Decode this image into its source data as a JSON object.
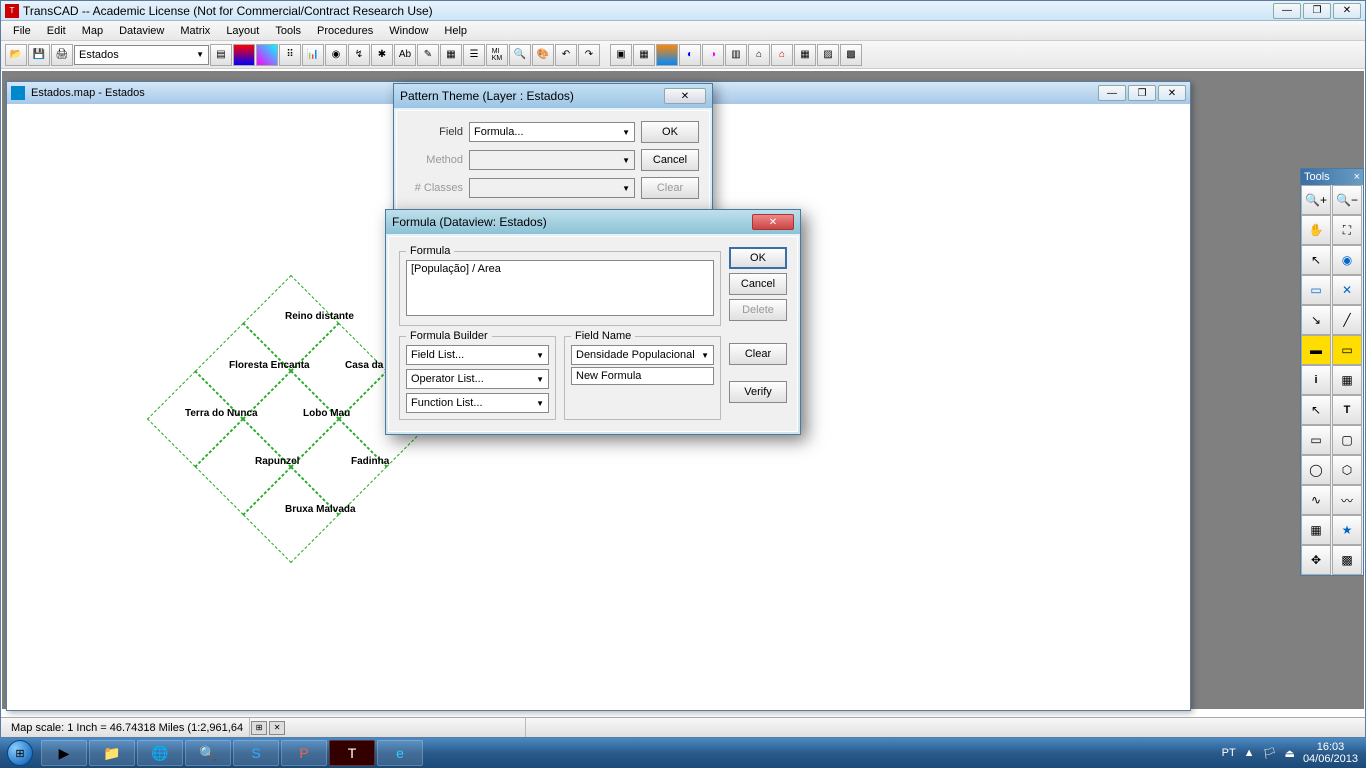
{
  "app": {
    "title": "TransCAD -- Academic License (Not for Commercial/Contract Research Use)",
    "menus": [
      "File",
      "Edit",
      "Map",
      "Dataview",
      "Matrix",
      "Layout",
      "Tools",
      "Procedures",
      "Window",
      "Help"
    ],
    "layer_combo": "Estados"
  },
  "map_window": {
    "title": "Estados.map - Estados",
    "regions": [
      "Reino distante",
      "Floresta Encanta",
      "Casa da",
      "Terra do Nunca",
      "Lobo Mau",
      "Rapunzel",
      "Fadinha",
      "Bruxa Malvada"
    ]
  },
  "pattern_dialog": {
    "title": "Pattern Theme (Layer : Estados)",
    "field_label": "Field",
    "field_value": "Formula...",
    "method_label": "Method",
    "classes_label": "# Classes",
    "ok": "OK",
    "cancel": "Cancel",
    "clear": "Clear"
  },
  "formula_dialog": {
    "title": "Formula (Dataview: Estados)",
    "formula_legend": "Formula",
    "formula_text": "[População] / Area",
    "builder_legend": "Formula Builder",
    "field_list": "Field List...",
    "operator_list": "Operator List...",
    "function_list": "Function List...",
    "fieldname_legend": "Field Name",
    "fieldname_value": "Densidade Populacional",
    "new_formula": "New Formula",
    "ok": "OK",
    "cancel": "Cancel",
    "delete": "Delete",
    "clear": "Clear",
    "verify": "Verify"
  },
  "tools_palette": {
    "title": "Tools"
  },
  "statusbar": {
    "scale": "Map scale: 1 Inch = 46.74318 Miles (1:2,961,64"
  },
  "taskbar": {
    "lang": "PT",
    "time": "16:03",
    "date": "04/06/2013"
  }
}
